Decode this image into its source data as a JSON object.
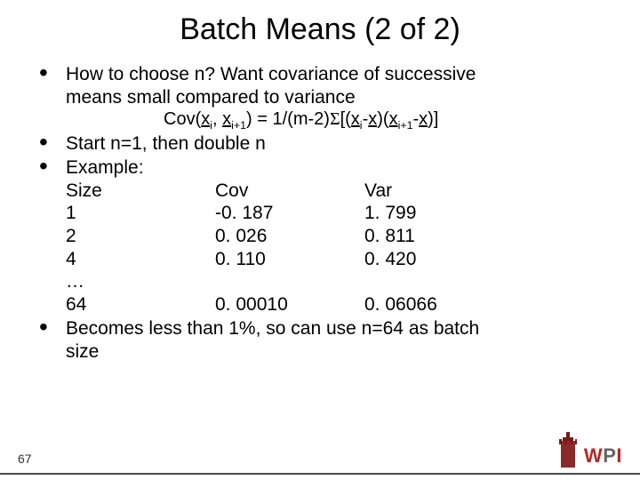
{
  "title": "Batch Means (2 of 2)",
  "bullets": {
    "b1_l1": "How to choose n? Want covariance of successive",
    "b1_l2": "means small compared to variance",
    "b2": "Start n=1, then double n",
    "b3": "Example:",
    "b4_l1": "Becomes less than 1%, so can use n=64 as batch",
    "b4_l2": "size"
  },
  "formula": {
    "cov_lhs_pre": "Cov(",
    "x": "x",
    "i": "i",
    "comma": ", ",
    "i1": "i+1",
    "close": ")",
    "eq": " = 1/(m-2)",
    "sigma": "Σ",
    "lb": "[(",
    "minus": "-",
    "rb": ")]"
  },
  "table": {
    "headers": [
      "Size",
      "Cov",
      "Var"
    ],
    "rows": [
      [
        "1",
        "-0. 187",
        "1. 799"
      ],
      [
        "2",
        "0. 026",
        "0. 811"
      ],
      [
        "4",
        "0. 110",
        "0. 420"
      ],
      [
        "…",
        "",
        ""
      ],
      [
        "64",
        "0. 00010",
        "0. 06066"
      ]
    ]
  },
  "slide_number": "67",
  "logo": {
    "w": "W",
    "p": "P",
    "i": "I"
  },
  "chart_data": {
    "type": "table",
    "title": "Batch means covariance vs variance by batch size",
    "columns": [
      "Size",
      "Cov",
      "Var"
    ],
    "rows": [
      {
        "Size": 1,
        "Cov": -0.187,
        "Var": 1.799
      },
      {
        "Size": 2,
        "Cov": 0.026,
        "Var": 0.811
      },
      {
        "Size": 4,
        "Cov": 0.11,
        "Var": 0.42
      },
      {
        "Size": 64,
        "Cov": 0.0001,
        "Var": 0.06066
      }
    ]
  }
}
